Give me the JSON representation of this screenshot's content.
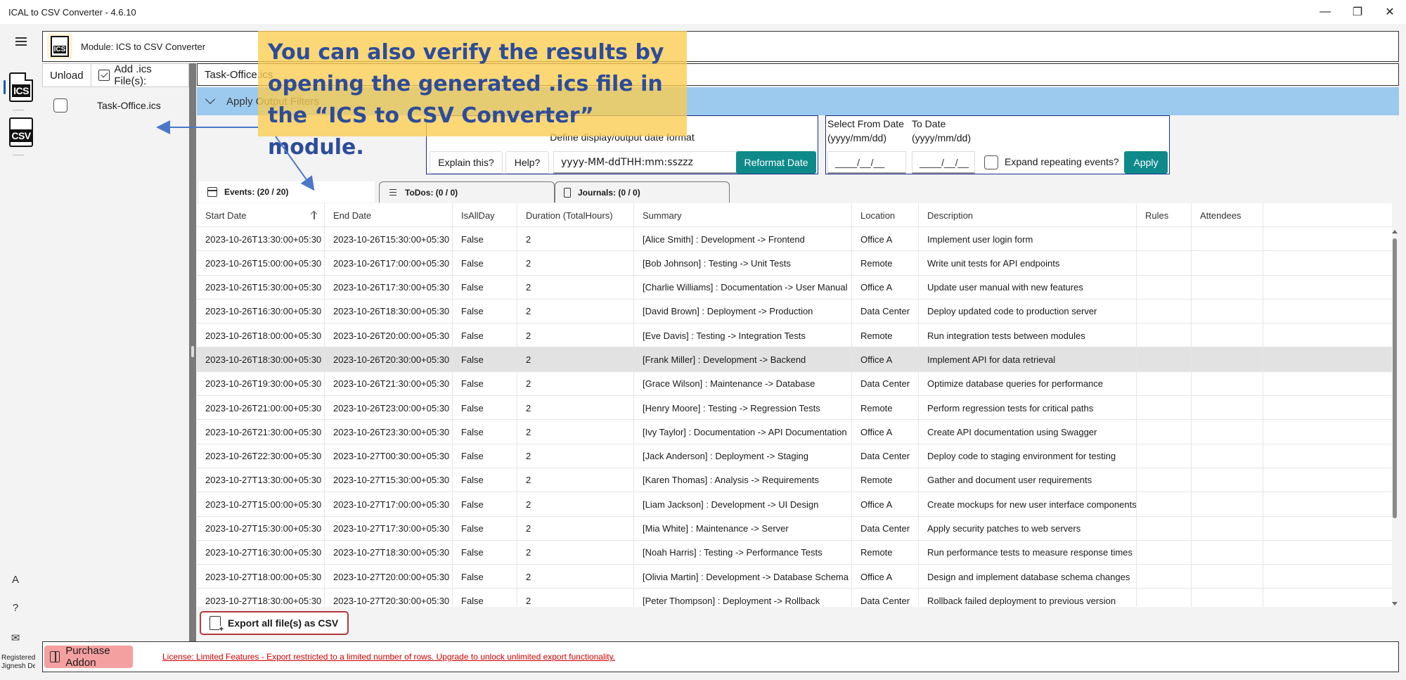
{
  "window": {
    "title": "ICAL to CSV Converter -  4.6.10",
    "minimize_glyph": "—",
    "restore_glyph": "❐",
    "close_glyph": "✕"
  },
  "nav": {
    "items": [
      {
        "label": "ICS",
        "icon": "ics-file-icon"
      },
      {
        "label": "CSV",
        "icon": "csv-file-icon"
      }
    ],
    "bottom": [
      {
        "glyph": "A",
        "icon": "language-icon"
      },
      {
        "glyph": "?",
        "icon": "help-icon"
      },
      {
        "glyph": "✉",
        "icon": "mail-icon"
      }
    ],
    "registered_line1": "Registered",
    "registered_line2": "Jignesh De"
  },
  "module": {
    "logo_label": "ICS",
    "title": "Module: ICS to CSV Converter"
  },
  "file_panel": {
    "unload_label": "Unload",
    "add_label": "Add .ics File(s):",
    "files": [
      "Task-Office.ics"
    ]
  },
  "main": {
    "file_tab": "Task-Office.ics",
    "filters_label": "Apply Output Filters",
    "date_format": {
      "caption": "Define display/output date format",
      "explain_label": "Explain this?",
      "help_label": "Help?",
      "format_value": "yyyy-MM-ddTHH:mm:sszzz",
      "reformat_label": "Reformat Date"
    },
    "date_range": {
      "from_label_1": "Select From Date",
      "from_label_2": "(yyyy/mm/dd)",
      "to_label_1": "To Date",
      "to_label_2": "(yyyy/mm/dd)",
      "from_value": "____/__/__",
      "to_value": "____/__/__",
      "expand_label": "Expand repeating events?",
      "apply_label": "Apply"
    },
    "tabs": [
      {
        "label": "Events: (20 / 20)"
      },
      {
        "label": "ToDos: (0 / 0)"
      },
      {
        "label": "Journals: (0 / 0)"
      }
    ],
    "export_label": "Export all file(s) as CSV"
  },
  "grid": {
    "columns": [
      "Start Date",
      "End Date",
      "IsAllDay",
      "Duration (TotalHours)",
      "Summary",
      "Location",
      "Description",
      "Rules",
      "Attendees"
    ],
    "rows": [
      [
        "2023-10-26T13:30:00+05:30",
        "2023-10-26T15:30:00+05:30",
        "False",
        "2",
        "[Alice Smith] : Development -> Frontend",
        "Office A",
        "Implement user login form",
        "",
        ""
      ],
      [
        "2023-10-26T15:00:00+05:30",
        "2023-10-26T17:00:00+05:30",
        "False",
        "2",
        "[Bob Johnson] : Testing -> Unit Tests",
        "Remote",
        "Write unit tests for API endpoints",
        "",
        ""
      ],
      [
        "2023-10-26T15:30:00+05:30",
        "2023-10-26T17:30:00+05:30",
        "False",
        "2",
        "[Charlie Williams] : Documentation -> User Manual",
        "Office A",
        "Update user manual with new features",
        "",
        ""
      ],
      [
        "2023-10-26T16:30:00+05:30",
        "2023-10-26T18:30:00+05:30",
        "False",
        "2",
        "[David Brown] : Deployment -> Production",
        "Data Center",
        "Deploy updated code to production server",
        "",
        ""
      ],
      [
        "2023-10-26T18:00:00+05:30",
        "2023-10-26T20:00:00+05:30",
        "False",
        "2",
        "[Eve Davis] : Testing -> Integration Tests",
        "Remote",
        "Run integration tests between modules",
        "",
        ""
      ],
      [
        "2023-10-26T18:30:00+05:30",
        "2023-10-26T20:30:00+05:30",
        "False",
        "2",
        "[Frank Miller] : Development -> Backend",
        "Office A",
        "Implement API for data retrieval",
        "",
        ""
      ],
      [
        "2023-10-26T19:30:00+05:30",
        "2023-10-26T21:30:00+05:30",
        "False",
        "2",
        "[Grace Wilson] : Maintenance -> Database",
        "Data Center",
        "Optimize database queries for performance",
        "",
        ""
      ],
      [
        "2023-10-26T21:00:00+05:30",
        "2023-10-26T23:00:00+05:30",
        "False",
        "2",
        "[Henry Moore] : Testing -> Regression Tests",
        "Remote",
        "Perform regression tests for critical paths",
        "",
        ""
      ],
      [
        "2023-10-26T21:30:00+05:30",
        "2023-10-26T23:30:00+05:30",
        "False",
        "2",
        "[Ivy Taylor] : Documentation -> API Documentation",
        "Office A",
        "Create API documentation using Swagger",
        "",
        ""
      ],
      [
        "2023-10-26T22:30:00+05:30",
        "2023-10-27T00:30:00+05:30",
        "False",
        "2",
        "[Jack Anderson] : Deployment -> Staging",
        "Data Center",
        "Deploy code to staging environment for testing",
        "",
        ""
      ],
      [
        "2023-10-27T13:30:00+05:30",
        "2023-10-27T15:30:00+05:30",
        "False",
        "2",
        "[Karen Thomas] : Analysis -> Requirements",
        "Remote",
        "Gather and document user requirements",
        "",
        ""
      ],
      [
        "2023-10-27T15:00:00+05:30",
        "2023-10-27T17:00:00+05:30",
        "False",
        "2",
        "[Liam Jackson] : Development -> UI Design",
        "Office A",
        "Create mockups for new user interface components",
        "",
        ""
      ],
      [
        "2023-10-27T15:30:00+05:30",
        "2023-10-27T17:30:00+05:30",
        "False",
        "2",
        "[Mia White] : Maintenance -> Server",
        "Data Center",
        "Apply security patches to web servers",
        "",
        ""
      ],
      [
        "2023-10-27T16:30:00+05:30",
        "2023-10-27T18:30:00+05:30",
        "False",
        "2",
        "[Noah Harris] : Testing -> Performance Tests",
        "Remote",
        "Run performance tests to measure response times",
        "",
        ""
      ],
      [
        "2023-10-27T18:00:00+05:30",
        "2023-10-27T20:00:00+05:30",
        "False",
        "2",
        "[Olivia Martin] : Development -> Database Schema",
        "Office A",
        "Design and implement database schema changes",
        "",
        ""
      ],
      [
        "2023-10-27T18:30:00+05:30",
        "2023-10-27T20:30:00+05:30",
        "False",
        "2",
        "[Peter Thompson] : Deployment -> Rollback",
        "Data Center",
        "Rollback failed deployment to previous version",
        "",
        ""
      ]
    ],
    "selected_row": 5
  },
  "license": {
    "purchase_label": "Purchase Addon",
    "message": "License: Limited Features - Export restricted to a limited number of rows. Upgrade to unlock unlimited export functionality."
  },
  "tutorial": {
    "callout_text": "You can also verify the results by opening the generated .ics file in the “ICS to CSV Converter” module.",
    "callout_color": "#fac850",
    "arrow_color": "#4a78c8"
  }
}
